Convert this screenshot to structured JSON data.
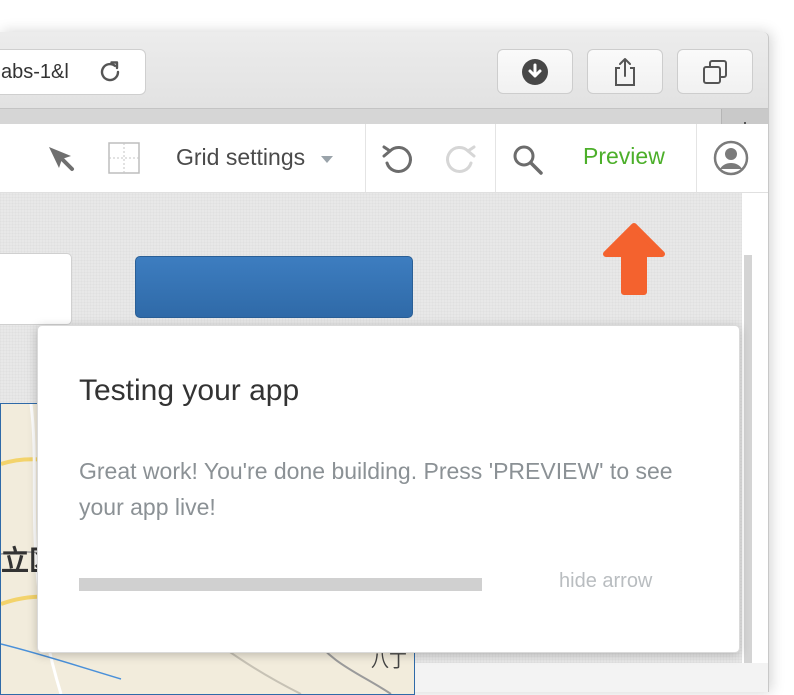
{
  "browser": {
    "url_fragment": "abs-1&l",
    "icons": [
      "reload-icon",
      "download-icon",
      "share-icon",
      "tabs-icon",
      "new-tab-icon"
    ]
  },
  "app_toolbar": {
    "grid_settings_label": "Grid settings",
    "preview_label": "Preview",
    "icons": [
      "select-pointer-icon",
      "grid-icon",
      "chevron-down-icon",
      "undo-icon",
      "redo-icon",
      "search-icon",
      "user-avatar-icon"
    ]
  },
  "canvas": {
    "map_label_1": "立区",
    "map_label_2": "八丁"
  },
  "popover": {
    "title": "Testing your app",
    "body": "Great work! You're done building. Press 'PREVIEW' to see your app live!",
    "progress": 1.0,
    "hide_arrow_label": "hide arrow"
  },
  "colors": {
    "preview_green": "#4caf2a",
    "arrow_orange": "#f4622e",
    "button_blue": "#3677b8"
  }
}
